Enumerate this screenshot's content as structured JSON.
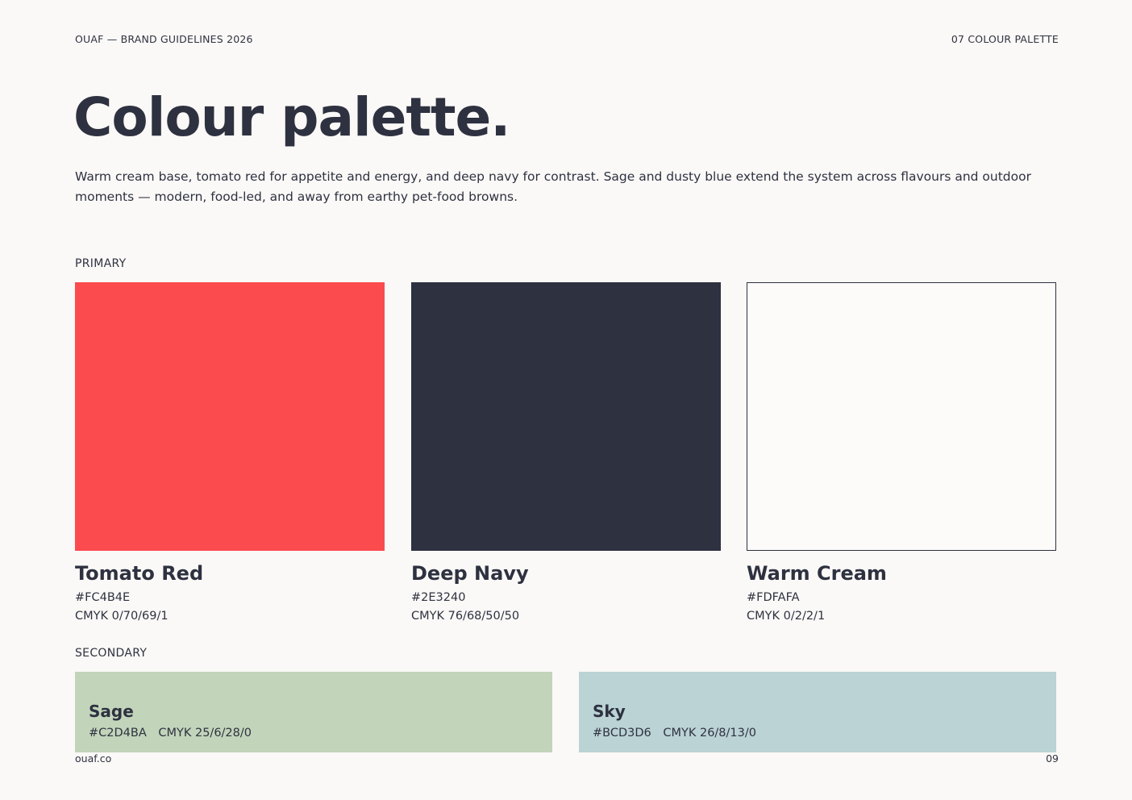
{
  "header": {
    "left": "OUAF — BRAND GUIDELINES 2026",
    "right": "07 COLOUR PALETTE"
  },
  "title": "Colour palette.",
  "intro": "Warm cream base, tomato red for appetite and energy, and deep navy for contrast. Sage and dusty blue extend the system across flavours and outdoor moments — modern, food-led, and away from earthy pet-food browns.",
  "primary": {
    "label": "PRIMARY",
    "colors": [
      {
        "name": "Tomato Red",
        "hex": "#FC4B4E",
        "cmyk": "CMYK 0/70/69/1"
      },
      {
        "name": "Deep Navy",
        "hex": "#2E3240",
        "cmyk": "CMYK 76/68/50/50"
      },
      {
        "name": "Warm Cream",
        "hex": "#FDFAFA",
        "cmyk": "CMYK 0/2/2/1"
      }
    ]
  },
  "secondary": {
    "label": "SECONDARY",
    "colors": [
      {
        "name": "Sage",
        "hex": "#C2D4BA",
        "cmyk": "CMYK 25/6/28/0"
      },
      {
        "name": "Sky",
        "hex": "#BCD3D6",
        "cmyk": "CMYK 26/8/13/0"
      }
    ]
  },
  "footer": {
    "left": "ouaf.co",
    "right": "09"
  }
}
